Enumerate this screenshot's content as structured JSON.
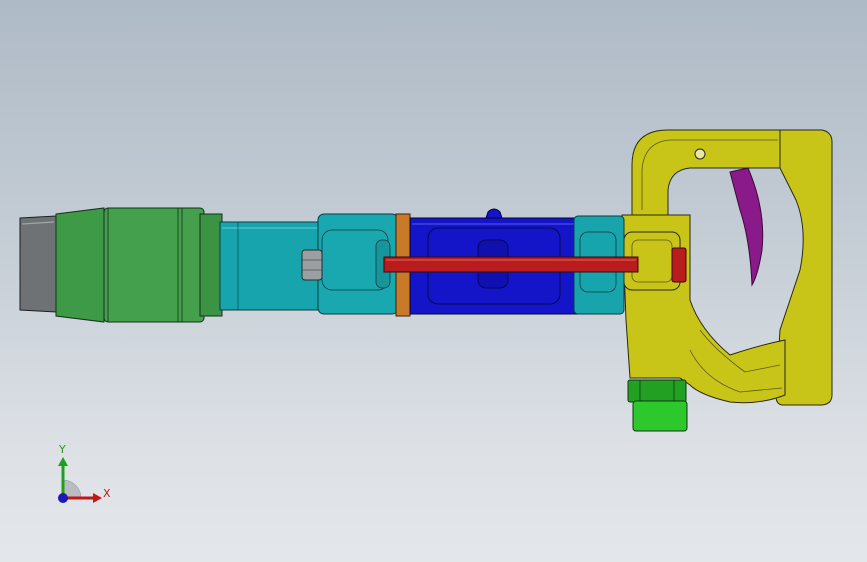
{
  "viewport": {
    "background_top": "#aebac6",
    "background_bottom": "#e4e7ea"
  },
  "model": {
    "name": "pneumatic-pick-hammer",
    "part_colors": {
      "chisel_tip": "#6f7274",
      "front_sleeve": "#3f9a48",
      "barrel": "#18a4ad",
      "cylinder_body": "#1414c8",
      "tie_rod": "#b81c1c",
      "gasket_ring": "#c87a28",
      "handle": "#c8c418",
      "trigger": "#8a1a8a",
      "air_inlet_fitting": "#22b822"
    }
  },
  "triad": {
    "y_label": "Y",
    "x_label": "X",
    "y_color": "#1aa31a",
    "x_color": "#c01818",
    "z_color": "#1a1ab8"
  }
}
